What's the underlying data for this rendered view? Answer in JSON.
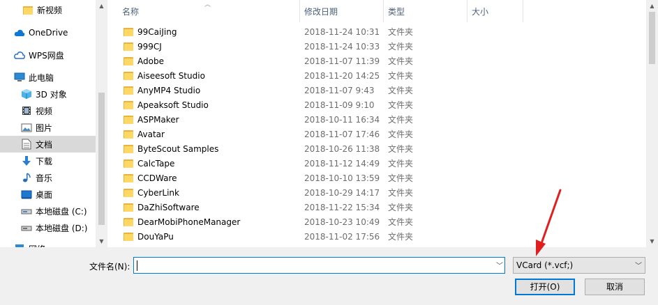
{
  "sidebar": {
    "items": [
      {
        "label": "新视频",
        "icon": "folder-icon"
      },
      {
        "label": "OneDrive",
        "icon": "onedrive-cloud-icon"
      },
      {
        "label": "WPS网盘",
        "icon": "wps-cloud-icon"
      },
      {
        "label": "此电脑",
        "icon": "computer-icon"
      },
      {
        "label": "3D 对象",
        "icon": "3d-objects-icon"
      },
      {
        "label": "视频",
        "icon": "video-icon"
      },
      {
        "label": "图片",
        "icon": "pictures-icon"
      },
      {
        "label": "文档",
        "icon": "documents-icon"
      },
      {
        "label": "下载",
        "icon": "download-icon"
      },
      {
        "label": "音乐",
        "icon": "music-icon"
      },
      {
        "label": "桌面",
        "icon": "desktop-icon"
      },
      {
        "label": "本地磁盘 (C:)",
        "icon": "drive-icon"
      },
      {
        "label": "本地磁盘 (D:)",
        "icon": "drive-icon"
      },
      {
        "label": "网络",
        "icon": "network-icon"
      }
    ]
  },
  "columns": {
    "name": "名称",
    "date": "修改日期",
    "type": "类型",
    "size": "大小"
  },
  "files": [
    {
      "name": "99CaiJing",
      "date": "2018-11-24 10:31",
      "type": "文件夹"
    },
    {
      "name": "999CJ",
      "date": "2018-11-24 10:33",
      "type": "文件夹"
    },
    {
      "name": "Adobe",
      "date": "2018-11-07 11:39",
      "type": "文件夹"
    },
    {
      "name": "Aiseesoft Studio",
      "date": "2018-11-20 14:25",
      "type": "文件夹"
    },
    {
      "name": "AnyMP4 Studio",
      "date": "2018-11-07 9:43",
      "type": "文件夹"
    },
    {
      "name": "Apeaksoft Studio",
      "date": "2018-11-09 9:10",
      "type": "文件夹"
    },
    {
      "name": "ASPMaker",
      "date": "2018-10-11 16:34",
      "type": "文件夹"
    },
    {
      "name": "Avatar",
      "date": "2018-11-07 17:46",
      "type": "文件夹"
    },
    {
      "name": "ByteScout Samples",
      "date": "2018-10-26 11:38",
      "type": "文件夹"
    },
    {
      "name": "CalcTape",
      "date": "2018-11-12 14:49",
      "type": "文件夹"
    },
    {
      "name": "CCDWare",
      "date": "2018-10-10 13:59",
      "type": "文件夹"
    },
    {
      "name": "CyberLink",
      "date": "2018-10-29 14:17",
      "type": "文件夹"
    },
    {
      "name": "DaZhiSoftware",
      "date": "2018-11-22 15:34",
      "type": "文件夹"
    },
    {
      "name": "DearMobiPhoneManager",
      "date": "2018-10-23 10:49",
      "type": "文件夹"
    },
    {
      "name": "DouYaPu",
      "date": "2018-11-02 17:56",
      "type": "文件夹"
    }
  ],
  "bottom": {
    "filename_label": "文件名(N):",
    "filename_value": "",
    "filetype_selected": "VCard (*.vcf;)",
    "open_label": "打开(O)",
    "cancel_label": "取消"
  },
  "colors": {
    "accent": "#0078d7",
    "annotation_arrow": "#e02020",
    "folder": "#ffd764"
  }
}
